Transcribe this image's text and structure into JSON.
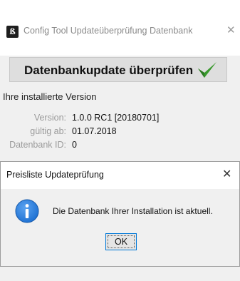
{
  "window": {
    "icon_glyph": "ß",
    "title": "Config Tool Updateüberprüfung Datenbank",
    "close_glyph": "✕"
  },
  "main": {
    "check_button_label": "Datenbankupdate überprüfen",
    "check_icon": "green-checkmark-icon",
    "section_heading": "Ihre installierte Version",
    "info": [
      {
        "label": "Version:",
        "value": "1.0.0 RC1 [20180701]"
      },
      {
        "label": "gültig ab:",
        "value": "01.07.2018"
      },
      {
        "label": "Datenbank ID:",
        "value": "0"
      }
    ]
  },
  "dialog": {
    "title": "Preisliste Updateprüfung",
    "close_glyph": "✕",
    "icon": "information-icon",
    "message": "Die Datenbank Ihrer Installation ist aktuell.",
    "ok_label": "OK"
  },
  "colors": {
    "accent": "#0078d7",
    "info_icon_blue": "#1c6fd1",
    "checkmark_green": "#3a9a2e"
  }
}
